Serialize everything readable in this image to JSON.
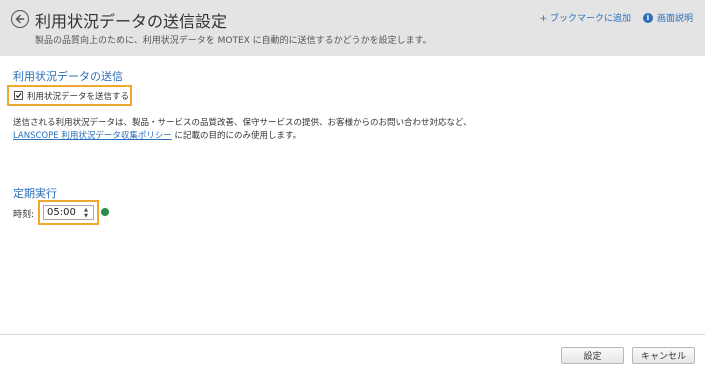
{
  "header": {
    "title": "利用状況データの送信設定",
    "subtitle": "製品の品質向上のために、利用状況データを MOTEX に自動的に送信するかどうかを設定します。",
    "bookmark_link": "+ ブックマークに追加",
    "help_icon_glyph": "i",
    "help_link": "画面説明"
  },
  "send_section": {
    "title": "利用状況データの送信",
    "checkbox_label": "利用状況データを送信する",
    "checked": true,
    "desc_line1": "送信される利用状況データは、製品・サービスの品質改善、保守サービスの提供、お客様からのお問い合わせ対応など、",
    "policy_link": "LANSCOPE 利用状況データ収集ポリシー",
    "desc_line2_suffix": " に記載の目的にのみ使用します。"
  },
  "schedule_section": {
    "title": "定期実行",
    "time_label": "時刻:",
    "time_value": "05:00"
  },
  "footer": {
    "ok_label": "設定",
    "cancel_label": "キャンセル"
  },
  "colors": {
    "accent": "#2a6ebb",
    "highlight": "#f0a830",
    "header_bg": "#e4e4e4"
  }
}
